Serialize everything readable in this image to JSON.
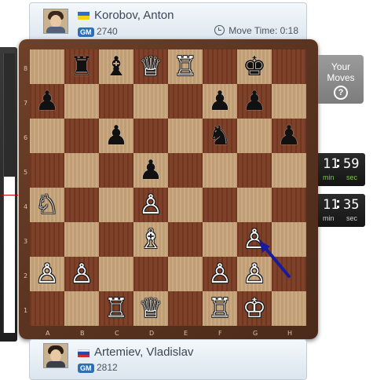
{
  "top_player": {
    "name": "Korobov, Anton",
    "title": "GM",
    "rating": "2740",
    "move_time_label": "Move Time: 0:18",
    "flag_colors": [
      "#2b6fd6",
      "#f5d313"
    ]
  },
  "bottom_player": {
    "name": "Artemiev, Vladislav",
    "title": "GM",
    "rating": "2812",
    "flag_colors": [
      "#ffffff",
      "#2548b8",
      "#d62a2a"
    ]
  },
  "board": {
    "light_square_color": "#c8a47a",
    "dark_square_color": "#7a3b22",
    "ranks": [
      "8",
      "7",
      "6",
      "5",
      "4",
      "3",
      "2",
      "1"
    ],
    "files": [
      "A",
      "B",
      "C",
      "D",
      "E",
      "F",
      "G",
      "H"
    ],
    "pieces": [
      {
        "square": "b8",
        "color": "black",
        "type": "rook",
        "glyph": "♜"
      },
      {
        "square": "c8",
        "color": "black",
        "type": "bishop",
        "glyph": "♝"
      },
      {
        "square": "d8",
        "color": "white",
        "type": "queen",
        "glyph": "♕"
      },
      {
        "square": "e8",
        "color": "white",
        "type": "rook",
        "glyph": "♖"
      },
      {
        "square": "g8",
        "color": "black",
        "type": "king",
        "glyph": "♚"
      },
      {
        "square": "a7",
        "color": "black",
        "type": "pawn",
        "glyph": "♟"
      },
      {
        "square": "f7",
        "color": "black",
        "type": "pawn",
        "glyph": "♟"
      },
      {
        "square": "g7",
        "color": "black",
        "type": "pawn",
        "glyph": "♟"
      },
      {
        "square": "c6",
        "color": "black",
        "type": "pawn",
        "glyph": "♟"
      },
      {
        "square": "f6",
        "color": "black",
        "type": "knight",
        "glyph": "♞"
      },
      {
        "square": "h6",
        "color": "black",
        "type": "pawn",
        "glyph": "♟"
      },
      {
        "square": "d5",
        "color": "black",
        "type": "pawn",
        "glyph": "♟"
      },
      {
        "square": "a4",
        "color": "white",
        "type": "knight",
        "glyph": "♘"
      },
      {
        "square": "d4",
        "color": "white",
        "type": "pawn",
        "glyph": "♙"
      },
      {
        "square": "d3",
        "color": "white",
        "type": "bishop",
        "glyph": "♗"
      },
      {
        "square": "g3",
        "color": "white",
        "type": "pawn",
        "glyph": "♙"
      },
      {
        "square": "a2",
        "color": "white",
        "type": "pawn",
        "glyph": "♙"
      },
      {
        "square": "b2",
        "color": "white",
        "type": "pawn",
        "glyph": "♙"
      },
      {
        "square": "f2",
        "color": "white",
        "type": "pawn",
        "glyph": "♙"
      },
      {
        "square": "g2",
        "color": "white",
        "type": "pawn",
        "glyph": "♙"
      },
      {
        "square": "c1",
        "color": "white",
        "type": "rook",
        "glyph": "♖"
      },
      {
        "square": "d1",
        "color": "white",
        "type": "queen",
        "glyph": "♕"
      },
      {
        "square": "f1",
        "color": "white",
        "type": "rook",
        "glyph": "♖"
      },
      {
        "square": "g1",
        "color": "white",
        "type": "king",
        "glyph": "♔"
      }
    ],
    "last_move_arrow": {
      "color": "#1a1aa0"
    }
  },
  "side_panel": {
    "your_moves_line1": "Your",
    "your_moves_line2": "Moves",
    "help_glyph": "?"
  },
  "clocks": {
    "top": {
      "minutes": "11",
      "seconds": "59",
      "min_unit": "min",
      "sec_unit": "sec"
    },
    "bottom": {
      "minutes": "11",
      "seconds": "35",
      "min_unit": "min",
      "sec_unit": "sec"
    }
  },
  "evaluation_bar": {
    "white_fraction": 0.56,
    "marker_color": "#d00000"
  }
}
